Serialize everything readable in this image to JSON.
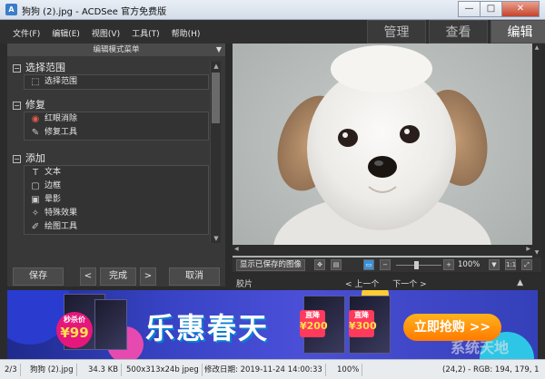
{
  "window": {
    "title": "狗狗 (2).jpg - ACDSee 官方免费版",
    "buttons": [
      "—",
      "□",
      "✕"
    ]
  },
  "menu": {
    "items": [
      "文件(F)",
      "编辑(E)",
      "视图(V)",
      "工具(T)",
      "帮助(H)"
    ]
  },
  "mode_tabs": [
    {
      "label": "管理",
      "active": false
    },
    {
      "label": "查看",
      "active": false
    },
    {
      "label": "编辑",
      "active": true
    }
  ],
  "edit_panel": {
    "header": "编辑模式菜单",
    "sections": [
      {
        "title": "选择范围",
        "tools": [
          {
            "label": "选择范围",
            "icon": "selection-icon"
          }
        ]
      },
      {
        "title": "修复",
        "tools": [
          {
            "label": "红眼消除",
            "icon": "red-eye-icon"
          },
          {
            "label": "修复工具",
            "icon": "repair-brush-icon"
          }
        ]
      },
      {
        "title": "添加",
        "tools": [
          {
            "label": "文本",
            "icon": "text-icon"
          },
          {
            "label": "边框",
            "icon": "border-icon"
          },
          {
            "label": "晕影",
            "icon": "vignette-icon"
          },
          {
            "label": "特殊效果",
            "icon": "special-effects-icon"
          },
          {
            "label": "绘图工具",
            "icon": "drawing-tools-icon"
          }
        ]
      }
    ]
  },
  "bottom_buttons": {
    "save": "保存",
    "prev": "<",
    "done": "完成",
    "next": ">",
    "cancel": "取消"
  },
  "view_toolbar": {
    "show_saved": "显示已保存的图像",
    "zoom": "100%",
    "zoom_minus": "−",
    "zoom_plus": "+",
    "fit_label": "1:1"
  },
  "filmstrip": {
    "title": "胶片",
    "prev": "< 上一个",
    "next": "下一个 >"
  },
  "banner": {
    "price_label": "秒杀价",
    "price": "¥99",
    "headline": "乐惠春天",
    "deal1_label": "直降",
    "deal1_value": "¥200",
    "deal2_label": "直降",
    "deal2_value": "¥300",
    "buy_button": "立即抢购 >>",
    "watermark": "系统天地"
  },
  "status": {
    "index": "2/3",
    "filename": "狗狗 (2).jpg",
    "size": "34.3 KB",
    "dimensions": "500x313x24b jpeg",
    "modified": "修改日期: 2019-11-24 14:00:33",
    "zoom": "100%",
    "pixel": "(24,2) - RGB: 194, 179, 1"
  },
  "colors": {
    "accent": "#3b8fd6",
    "panel_bg": "#383838",
    "banner_bg": "#3743c4",
    "buy_button": "#ff7a00"
  }
}
